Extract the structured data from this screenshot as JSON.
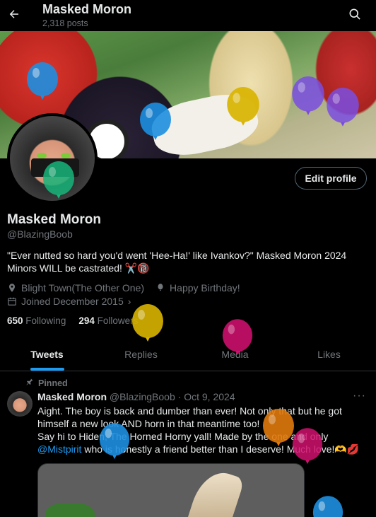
{
  "header": {
    "title": "Masked Moron",
    "post_count": "2,318 posts"
  },
  "icons": {
    "back": "back-arrow-icon",
    "search": "search-icon",
    "location": "location-icon",
    "birthday": "balloon-icon",
    "calendar": "calendar-icon",
    "pin": "pin-icon",
    "more": "more-icon"
  },
  "profile": {
    "edit_label": "Edit profile",
    "name": "Masked Moron",
    "handle": "@BlazingBoob",
    "bio": "\"Ever nutted so hard you'd went 'Hee-Ha!' like Ivankov?\" Masked Moron 2024 Minors WILL be castrated! ✂️🔞",
    "location": "Blight Town(The Other One)",
    "birthday": "Happy Birthday!",
    "joined": "Joined December 2015",
    "following_count": "650",
    "following_label": "Following",
    "followers_count": "294",
    "followers_label": "Followers"
  },
  "tabs": [
    {
      "label": "Tweets",
      "active": true
    },
    {
      "label": "Replies",
      "active": false
    },
    {
      "label": "Media",
      "active": false
    },
    {
      "label": "Likes",
      "active": false
    }
  ],
  "pinned_tweet": {
    "pinned_label": "Pinned",
    "author": "Masked Moron",
    "handle": "@BlazingBoob",
    "date": "Oct 9, 2024",
    "more": "···",
    "text_part1": "Aight. The boy is back and dumber than ever! Not only that but he got himself a new look AND horn in that meantime too!",
    "text_part2": "Say hi to Hiden, The Horned Horny yall! Made by the one and only",
    "mention": "@Mistpirit",
    "text_part3": "who is honestly a friend better than I deserve! Much love!🫶💋"
  },
  "colors": {
    "accent": "#1d9bf0",
    "balloon_blue": "#1d8fe0",
    "balloon_yellow": "#d9b400",
    "balloon_purple": "#7a4de0",
    "balloon_green": "#17b47a",
    "balloon_pink": "#d0106e",
    "balloon_orange": "#e07a0c"
  }
}
